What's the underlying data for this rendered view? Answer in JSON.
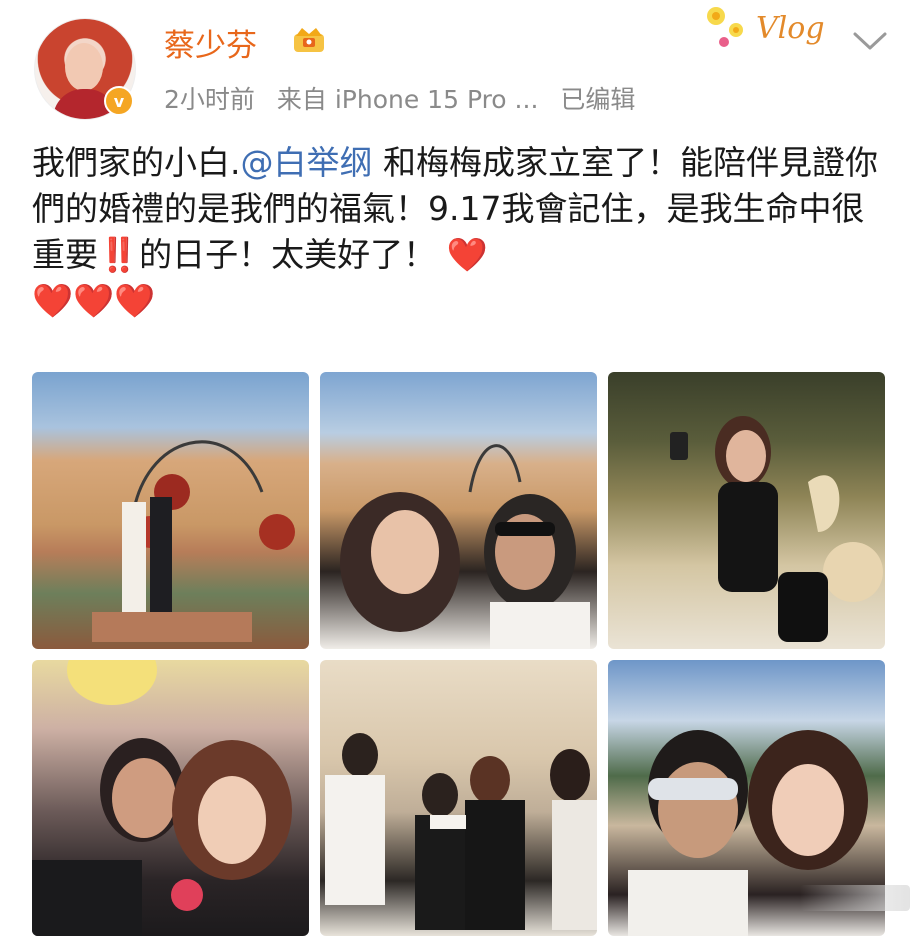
{
  "author": {
    "name": "蔡少芬",
    "avatar_icon": "avatar-portrait",
    "verified_badge": "v",
    "crown_icon": "crown-icon"
  },
  "meta": {
    "time": "2小时前",
    "source": "来自 iPhone 15 Pro ...",
    "edited": "已编辑"
  },
  "decoration": {
    "vlog_sticker": "Vlog"
  },
  "post": {
    "text_before": "我們家的小白.",
    "mention": "@白举纲",
    "text_mid": " 和梅梅成家立室了！能陪伴見證你們的婚禮的是我們的福氣！9.17我會記住，是我生命中很重要",
    "emphasis": "‼️",
    "text_after": "的日子！太美好了！",
    "hearts_inline": "❤️",
    "hearts_end": "❤️❤️❤️"
  },
  "photos": [
    {
      "id": "photo-1",
      "scene": "wedding-kiss-desert"
    },
    {
      "id": "photo-2",
      "scene": "selfie-desert-arch"
    },
    {
      "id": "photo-3",
      "scene": "woman-selfie-phone"
    },
    {
      "id": "photo-4",
      "scene": "selfie-night"
    },
    {
      "id": "photo-5",
      "scene": "birthday-cake-stage"
    },
    {
      "id": "photo-6",
      "scene": "selfie-sky"
    }
  ],
  "colors": {
    "username": "#e8671b",
    "mention": "#3f6eb3",
    "meta": "#8a8a8a",
    "heart": "#e02020"
  }
}
